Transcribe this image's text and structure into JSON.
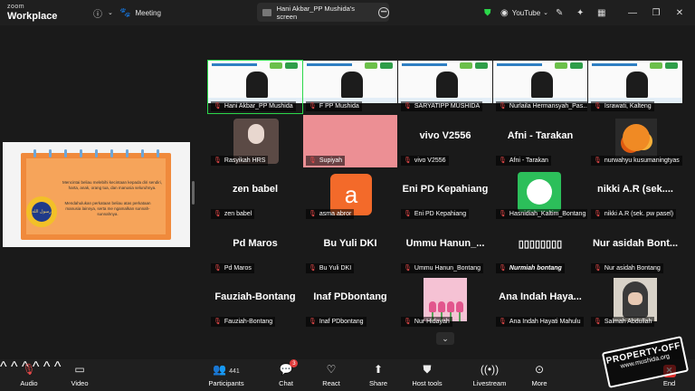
{
  "app": {
    "brand_top": "zoom",
    "brand_bottom": "Workplace"
  },
  "topbar": {
    "info_icon": "info-icon",
    "meeting_label": "Meeting",
    "screen_share_label": "Hani Akbar_PP Mushida's screen",
    "youtube_label": "YouTube",
    "status_color": "#2bd74a"
  },
  "share": {
    "text1": "Mencintai beliau melebihi kecintaan kepada diri sendiri, harta, anak, orang tua, dan manusia seluruhnya.",
    "text2": "Mendahulukan perkataan beliau atas perkataan manusia lainnya, serta me ngamalkan sunnah-sunnahnya.",
    "seal_text": "رسول الله"
  },
  "tiles": [
    {
      "name": "Hani Akbar_PP Mushida",
      "big": "",
      "kind": "slide",
      "active": true
    },
    {
      "name": "F PP Mushida",
      "big": "",
      "kind": "slide"
    },
    {
      "name": "SARYATIPP MUSHIDA",
      "big": "",
      "kind": "slide"
    },
    {
      "name": "Nurlaila Hermansyah_Pas...",
      "big": "",
      "kind": "slide"
    },
    {
      "name": "Israwati, Kalteng",
      "big": "",
      "kind": "slide"
    },
    {
      "name": "Rasyikah HRS",
      "big": "",
      "kind": "face"
    },
    {
      "name": "Supiyah",
      "big": "",
      "kind": "pink"
    },
    {
      "name": "vivo V2556",
      "big": "vivo V2556",
      "kind": "text"
    },
    {
      "name": "Afni - Tarakan",
      "big": "Afni - Tarakan",
      "kind": "text"
    },
    {
      "name": "nurwahyu kusumaningtyas",
      "big": "",
      "kind": "flower"
    },
    {
      "name": "zen babel",
      "big": "zen babel",
      "kind": "text"
    },
    {
      "name": "asma abror",
      "big": "",
      "kind": "avatar",
      "avatar_letter": "a"
    },
    {
      "name": "Eni PD Kepahiang",
      "big": "Eni PD Kepahiang",
      "kind": "text"
    },
    {
      "name": "Hasnidiah_Kaltim_Bontang",
      "big": "",
      "kind": "green"
    },
    {
      "name": "nikki A.R (sek. pw pasel)",
      "big": "nikki A.R (sek....",
      "kind": "text"
    },
    {
      "name": "Pd Maros",
      "big": "Pd Maros",
      "kind": "text"
    },
    {
      "name": "Bu Yuli DKI",
      "big": "Bu Yuli DKI",
      "kind": "text"
    },
    {
      "name": "Ummu Hanun_Bontang",
      "big": "Ummu Hanun_...",
      "kind": "text"
    },
    {
      "name": "Nurmiah bontang",
      "big": "▯▯▯▯▯▯▯▯",
      "kind": "text",
      "italic": true
    },
    {
      "name": "Nur asidah Bontang",
      "big": "Nur asidah Bont...",
      "kind": "text"
    },
    {
      "name": "Fauziah-Bontang",
      "big": "Fauziah-Bontang",
      "kind": "text"
    },
    {
      "name": "Inaf PDbontang",
      "big": "Inaf PDbontang",
      "kind": "text"
    },
    {
      "name": "Nur Hidayah",
      "big": "",
      "kind": "tulips"
    },
    {
      "name": "Ana Indah Hayati Mahulu",
      "big": "Ana Indah Haya...",
      "kind": "text"
    },
    {
      "name": "Salmah Abdullah",
      "big": "",
      "kind": "hijab"
    }
  ],
  "toolbar": {
    "audio": "Audio",
    "video": "Video",
    "participants": "Participants",
    "participants_count": "441",
    "chat": "Chat",
    "chat_badge": "3",
    "react": "React",
    "share": "Share",
    "host_tools": "Host tools",
    "livestream": "Livestream",
    "more": "More",
    "end": "End"
  },
  "watermark": {
    "line1": "PROPERTY-OFF",
    "line2": "www.mushida.org"
  }
}
